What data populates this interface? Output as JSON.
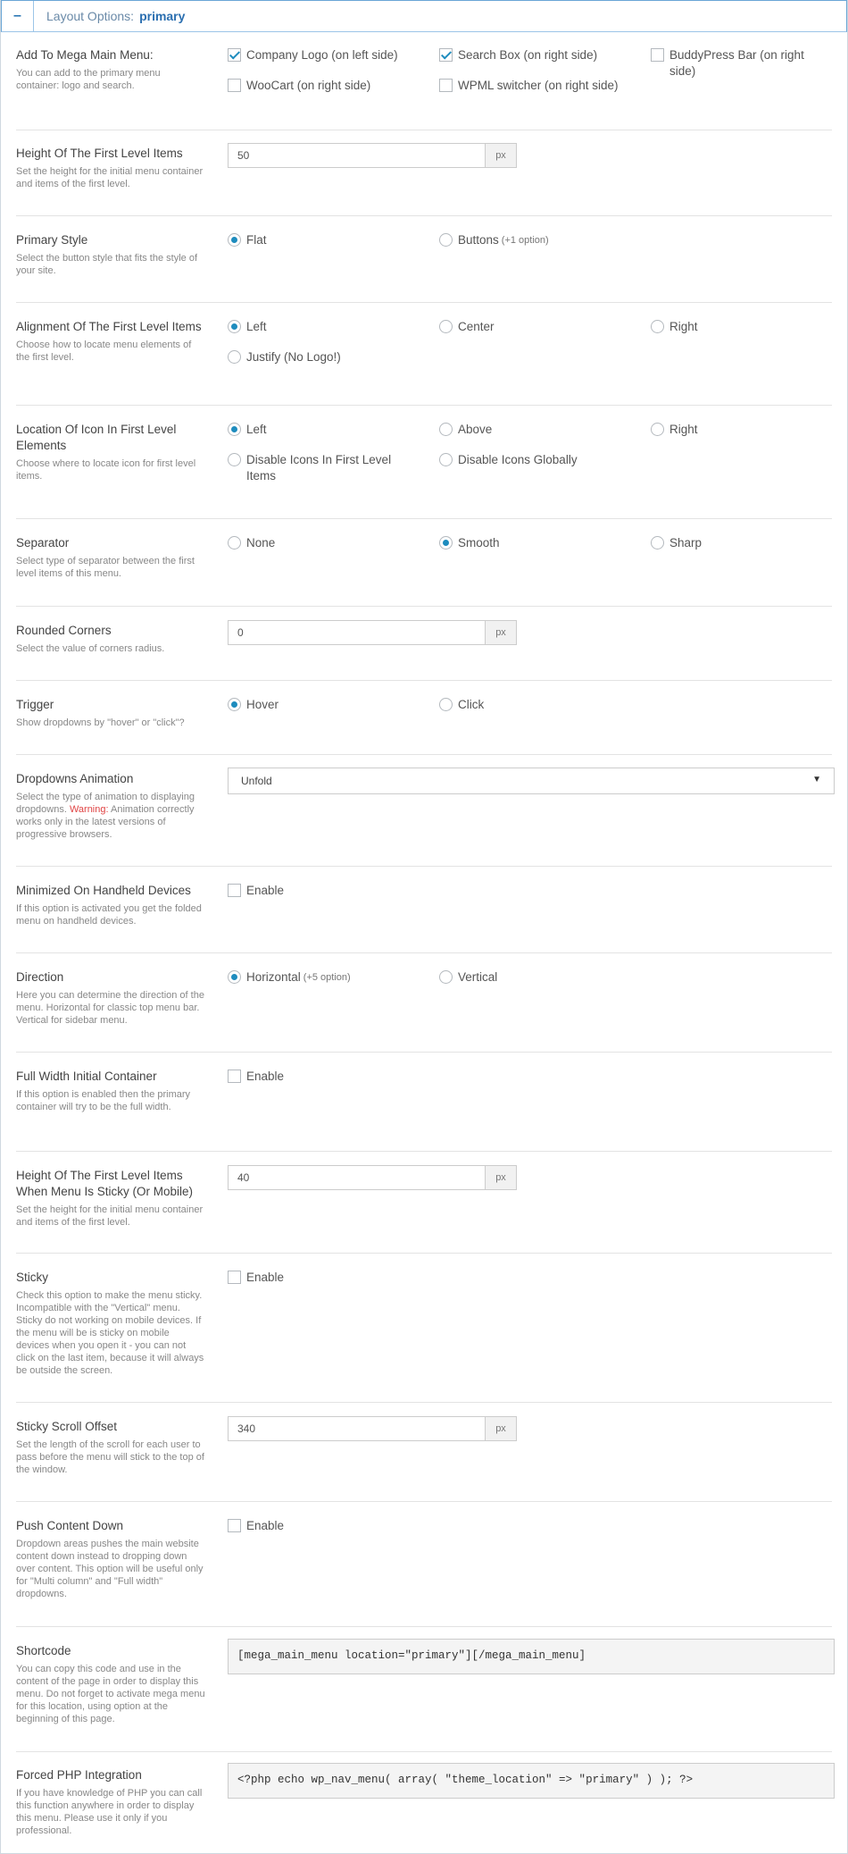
{
  "header": {
    "toggle": "–",
    "prefix": "Layout Options:",
    "location": "primary"
  },
  "rows": {
    "add_to_menu": {
      "title": "Add To Mega Main Menu:",
      "desc": "You can add to the primary menu container: logo and search.",
      "options": [
        {
          "label": "Company Logo (on left side)",
          "checked": true
        },
        {
          "label": "Search Box (on right side)",
          "checked": true
        },
        {
          "label": "BuddyPress Bar (on right side)",
          "checked": false
        },
        {
          "label": "WooCart (on right side)",
          "checked": false
        },
        {
          "label": "WPML switcher (on right side)",
          "checked": false
        }
      ]
    },
    "height_first": {
      "title": "Height Of The First Level Items",
      "desc": "Set the height for the initial menu container and items of the first level.",
      "value": "50",
      "unit": "px"
    },
    "primary_style": {
      "title": "Primary Style",
      "desc": "Select the button style that fits the style of your site.",
      "options": [
        {
          "label": "Flat",
          "extra": "",
          "checked": true
        },
        {
          "label": "Buttons",
          "extra": "(+1 option)",
          "checked": false
        }
      ]
    },
    "alignment": {
      "title": "Alignment Of The First Level Items",
      "desc": "Choose how to locate menu elements of the first level.",
      "options": [
        {
          "label": "Left",
          "checked": true
        },
        {
          "label": "Center",
          "checked": false
        },
        {
          "label": "Right",
          "checked": false
        },
        {
          "label": "Justify (No Logo!)",
          "checked": false
        }
      ]
    },
    "icon_location": {
      "title": "Location Of Icon In First Level Elements",
      "desc": "Choose where to locate icon for first level items.",
      "options": [
        {
          "label": "Left",
          "checked": true
        },
        {
          "label": "Above",
          "checked": false
        },
        {
          "label": "Right",
          "checked": false
        },
        {
          "label": "Disable Icons In First Level Items",
          "checked": false
        },
        {
          "label": "Disable Icons Globally",
          "checked": false
        }
      ]
    },
    "separator": {
      "title": "Separator",
      "desc": "Select type of separator between the first level items of this menu.",
      "options": [
        {
          "label": "None",
          "checked": false
        },
        {
          "label": "Smooth",
          "checked": true
        },
        {
          "label": "Sharp",
          "checked": false
        }
      ]
    },
    "rounded": {
      "title": "Rounded Corners",
      "desc": "Select the value of corners radius.",
      "value": "0",
      "unit": "px"
    },
    "trigger": {
      "title": "Trigger",
      "desc": "Show dropdowns by \"hover\" or \"click\"?",
      "options": [
        {
          "label": "Hover",
          "checked": true
        },
        {
          "label": "Click",
          "checked": false
        }
      ]
    },
    "animation": {
      "title": "Dropdowns Animation",
      "desc_before": "Select the type of animation to displaying dropdowns.",
      "warning": "Warning:",
      "desc_after": "Animation correctly works only in the latest versions of progressive browsers.",
      "selected": "Unfold",
      "arrow": "▼"
    },
    "minimized": {
      "title": "Minimized On Handheld Devices",
      "desc": "If this option is activated you get the folded menu on handheld devices.",
      "option": {
        "label": "Enable",
        "checked": false
      }
    },
    "direction": {
      "title": "Direction",
      "desc": "Here you can determine the direction of the menu. Horizontal for classic top menu bar. Vertical for sidebar menu.",
      "options": [
        {
          "label": "Horizontal",
          "extra": "(+5 option)",
          "checked": true
        },
        {
          "label": "Vertical",
          "extra": "",
          "checked": false
        }
      ]
    },
    "full_width": {
      "title": "Full Width Initial Container",
      "desc": "If this option is enabled then the primary container will try to be the full width.",
      "option": {
        "label": "Enable",
        "checked": false
      }
    },
    "height_sticky": {
      "title": "Height Of The First Level Items When Menu Is Sticky (Or Mobile)",
      "desc": "Set the height for the initial menu container and items of the first level.",
      "value": "40",
      "unit": "px"
    },
    "sticky": {
      "title": "Sticky",
      "desc": "Check this option to make the menu sticky. Incompatible with the \"Vertical\" menu. Sticky do not working on mobile devices. If the menu will be is sticky on mobile devices when you open it - you can not click on the last item, because it will always be outside the screen.",
      "option": {
        "label": "Enable",
        "checked": false
      }
    },
    "sticky_offset": {
      "title": "Sticky Scroll Offset",
      "desc": "Set the length of the scroll for each user to pass before the menu will stick to the top of the window.",
      "value": "340",
      "unit": "px"
    },
    "push_content": {
      "title": "Push Content Down",
      "desc": "Dropdown areas pushes the main website content down instead to dropping down over content. This option will be useful only for \"Multi column\" and \"Full width\" dropdowns.",
      "option": {
        "label": "Enable",
        "checked": false
      }
    },
    "shortcode": {
      "title": "Shortcode",
      "desc": "You can copy this code and use in the content of the page in order to display this menu. Do not forget to activate mega menu for this location, using option at the beginning of this page.",
      "code": "[mega_main_menu location=\"primary\"][/mega_main_menu]"
    },
    "php": {
      "title": "Forced PHP Integration",
      "desc": "If you have knowledge of PHP you can call this function anywhere in order to display this menu. Please use it only if you professional.",
      "code": "<?php echo wp_nav_menu( array( \"theme_location\" => \"primary\" ) ); ?>"
    }
  }
}
